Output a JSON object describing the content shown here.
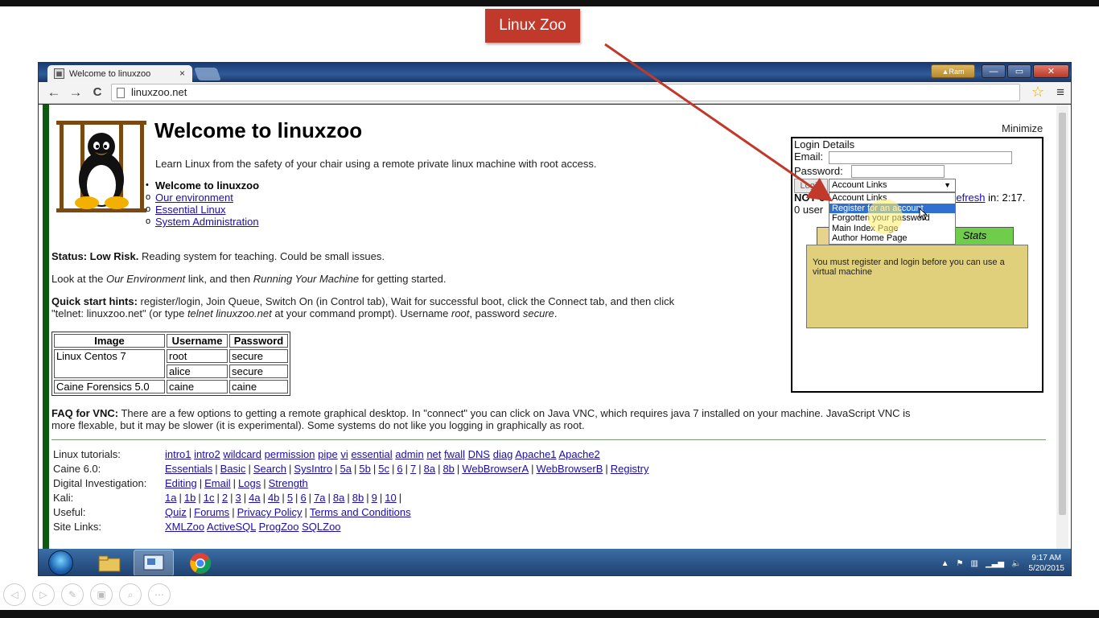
{
  "callout": {
    "label": "Linux Zoo"
  },
  "browser": {
    "tab_title": "Welcome to linuxzoo",
    "tab_close": "×",
    "url": "linuxzoo.net",
    "user_label": "Ram",
    "nav": {
      "back": "←",
      "forward": "→",
      "reload": "C"
    },
    "star": "☆",
    "menu": "≡",
    "win": {
      "min": "—",
      "max": "▭",
      "close": "✕"
    }
  },
  "page": {
    "title": "Welcome to linuxzoo",
    "intro": "Learn Linux from the safety of your chair using a remote private linux machine with root access.",
    "nav": [
      {
        "label": "Welcome to linuxzoo",
        "current": true,
        "bullet": "•"
      },
      {
        "label": "Our environment",
        "current": false,
        "bullet": "o"
      },
      {
        "label": "Essential Linux",
        "current": false,
        "bullet": "o"
      },
      {
        "label": "System Administration",
        "current": false,
        "bullet": "o"
      }
    ],
    "status_label": "Status: Low Risk.",
    "status_text": " Reading system for teaching. Could be small issues.",
    "look_1": "Look at the ",
    "look_2": "Our Environment",
    "look_3": " link, and then ",
    "look_4": "Running Your Machine",
    "look_5": " for getting started.",
    "hints_label": "Quick start hints:",
    "hints_1": " register/login, Join Queue, Switch On (in Control tab), Wait for successful boot, click the Connect tab, and then click",
    "hints_2": "\"telnet: linuxzoo.net\" (or type ",
    "hints_3": "telnet linuxzoo.net",
    "hints_4": " at your command prompt). Username ",
    "hints_5": "root",
    "hints_6": ", password ",
    "hints_7": "secure",
    "hints_8": ".",
    "table": {
      "headers": [
        "Image",
        "Username",
        "Password"
      ],
      "rows": [
        [
          "Linux Centos 7",
          "root",
          "secure"
        ],
        [
          "alice",
          "secure"
        ],
        [
          "Caine Forensics 5.0",
          "caine",
          "caine"
        ]
      ]
    },
    "faq_label": "FAQ for VNC:",
    "faq_text": " There are a few options to getting a remote graphical desktop. In \"connect\" you can click on Java VNC, which requires java 7 installed on your machine. JavaScript VNC is",
    "faq_text2": "more flexable, but it may be slower (it is experimental). Some systems do not like you logging in graphically as root.",
    "links": [
      {
        "label": "Linux tutorials:",
        "items": [
          "intro1",
          "intro2",
          "wildcard",
          "permission",
          "pipe",
          "vi",
          "essential",
          "admin",
          "net",
          "fwall",
          "DNS",
          "diag",
          "Apache1",
          "Apache2"
        ],
        "pipes": false
      },
      {
        "label": "Caine 6.0:",
        "items": [
          "Essentials",
          "Basic",
          "Search",
          "SysIntro",
          "5a",
          "5b",
          "5c",
          "6",
          "7",
          "8a",
          "8b",
          "WebBrowserA",
          "WebBrowserB",
          "Registry"
        ],
        "pipes": true
      },
      {
        "label": "Digital Investigation:",
        "items": [
          "Editing",
          "Email",
          "Logs",
          "Strength"
        ],
        "pipes": true
      },
      {
        "label": "Kali:",
        "items": [
          "1a",
          "1b",
          "1c",
          "2",
          "3",
          "4a",
          "4b",
          "5",
          "6",
          "7a",
          "8a",
          "8b",
          "9",
          "10"
        ],
        "pipes": true,
        "trailing_pipe": true
      },
      {
        "label": "Useful:",
        "items": [
          "Quiz",
          "Forums",
          "Privacy Policy",
          "Terms and Conditions"
        ],
        "pipes": true
      },
      {
        "label": "Site Links:",
        "items": [
          "XMLZoo",
          "ActiveSQL",
          "ProgZoo",
          "SQLZoo"
        ],
        "pipes": false
      }
    ]
  },
  "login": {
    "minimize": "Minimize",
    "heading": "Login Details",
    "email_label": "Email:",
    "password_label": "Password:",
    "login_button": "Login",
    "select_value": "Account Links",
    "options": [
      "Account Links",
      "Register for an account",
      "Forgotten your password",
      "Main Index Page",
      "Author Home Page"
    ],
    "highlighted_index": 1,
    "not_text": "NOT c",
    "users_text": "0 user",
    "refresh_link": "Refresh",
    "refresh_prefix": "R",
    "refresh_suffix": " in: 2:17.",
    "stats_tab": "Stats",
    "info": "You must register and login before you can use a virtual machine"
  },
  "taskbar": {
    "time": "9:17 AM",
    "date": "5/20/2015"
  },
  "colors": {
    "callout": "#c0392b",
    "link": "#1a0dab",
    "green_bar": "#0c5a12",
    "panel": "#e1d07b",
    "stats_tab": "#6fcd4b"
  }
}
